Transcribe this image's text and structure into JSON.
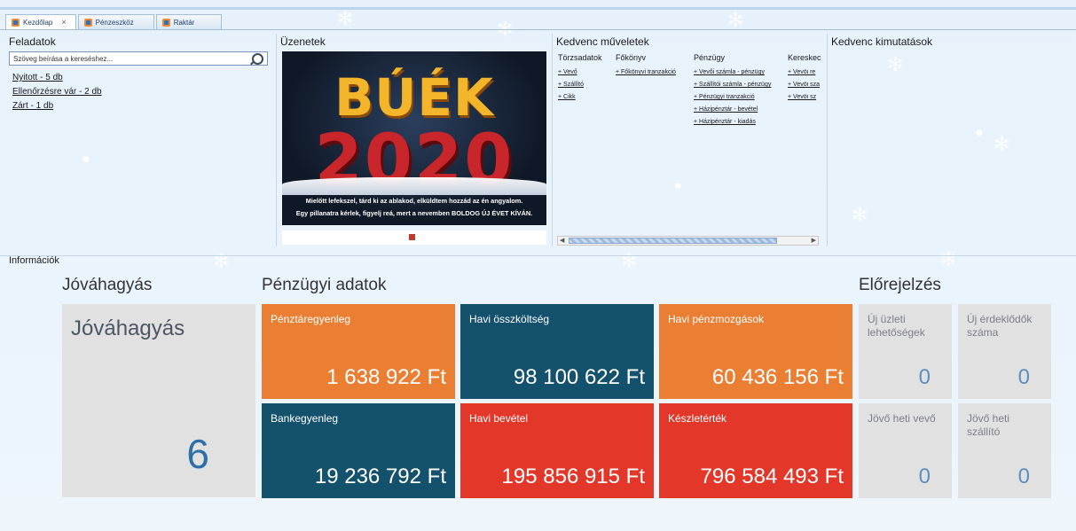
{
  "tabs": [
    {
      "label": "Kezdőlap",
      "closable": true
    },
    {
      "label": "Pénzeszköz",
      "closable": false
    },
    {
      "label": "Raktár",
      "closable": false
    }
  ],
  "tasks": {
    "title": "Feladatok",
    "search_placeholder": "Szöveg beírása a kereséshez...",
    "items": [
      "Nyitott - 5 db",
      "Ellenőrzésre vár - 2 db",
      "Zárt - 1 db"
    ]
  },
  "messages": {
    "title": "Üzenetek",
    "banner_title": "BÚÉK",
    "banner_year": "2020",
    "banner_line1": "Mielőtt lefekszel, tárd ki az ablakod, elküldtem hozzád az én angyalom.",
    "banner_line2": "Egy pillanatra kérlek, figyelj reá, mert a nevemben BOLDOG ÚJ ÉVET KÍVÁN."
  },
  "favorites": {
    "title": "Kedvenc műveletek",
    "columns": [
      {
        "head": "Törzsadatok",
        "links": [
          "+ Vevő",
          "+ Szállító",
          "+ Cikk"
        ]
      },
      {
        "head": "Főkönyv",
        "links": [
          "+ Főkönyvi tranzakció"
        ]
      },
      {
        "head": "Pénzügy",
        "links": [
          "+ Vevői számla - pénzügy",
          "+ Szállítói számla - pénzügy",
          "+ Pénzügyi tranzakció",
          "+ Házipénztár - bevétel",
          "+ Házipénztár - kiadás"
        ]
      },
      {
        "head": "Kereskec",
        "links": [
          "+ Vevői re",
          "+ Vevői sza",
          "+ Vevői sz"
        ]
      }
    ]
  },
  "reports": {
    "title": "Kedvenc kimutatások"
  },
  "info": {
    "title": "Információk",
    "approval": {
      "section": "Jóváhagyás",
      "tile_label": "Jóváhagyás",
      "value": "6"
    },
    "finance": {
      "section": "Pénzügyi adatok",
      "tiles": [
        {
          "label": "Pénztáregyenleg",
          "value": "1 638 922 Ft"
        },
        {
          "label": "Havi összköltség",
          "value": "98 100 622 Ft"
        },
        {
          "label": "Havi pénzmozgások",
          "value": "60 436 156 Ft"
        },
        {
          "label": "Bankegyenleg",
          "value": "19 236 792 Ft"
        },
        {
          "label": "Havi bevétel",
          "value": "195 856 915 Ft"
        },
        {
          "label": "Készletérték",
          "value": "796 584 493 Ft"
        }
      ]
    },
    "forecast": {
      "section": "Előrejelzés",
      "tiles": [
        {
          "label": "Új üzleti lehetőségek",
          "value": "0"
        },
        {
          "label": "Új érdeklődők száma",
          "value": "0"
        },
        {
          "label": "Jövő heti vevő",
          "value": "0"
        },
        {
          "label": "Jövő heti szállító",
          "value": "0"
        }
      ]
    }
  },
  "colors": {
    "orange": "#ea7f33",
    "teal": "#14516d",
    "red": "#e3372a",
    "grey": "#e1e1e1"
  }
}
